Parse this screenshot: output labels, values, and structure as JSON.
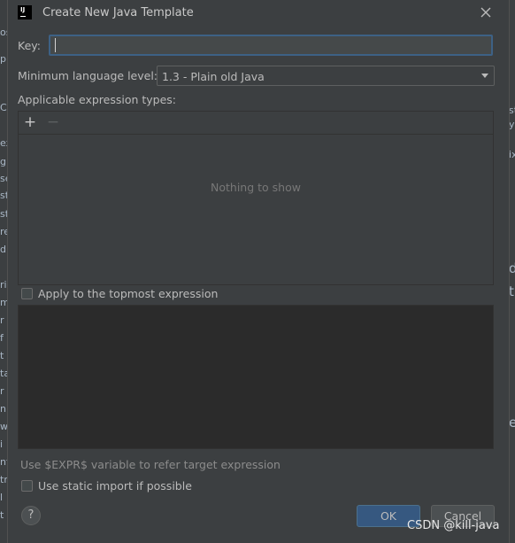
{
  "background_ide": {
    "left_fragments": [
      "os",
      "p",
      "Co",
      "ex",
      "g",
      "se",
      "st",
      "st",
      "re",
      "d",
      "ri",
      "m",
      "r",
      "f",
      "t",
      "ta",
      "r",
      "nl",
      "w",
      "i",
      "nt",
      "tr",
      "l",
      "t"
    ],
    "right_fragments": [
      "st",
      "y(",
      "ix",
      "d",
      "t",
      "e"
    ]
  },
  "dialog": {
    "title": "Create New Java Template",
    "app_icon_text": "IJ",
    "close_icon": "close-icon"
  },
  "form": {
    "key_label": "Key:",
    "key_value": "",
    "min_level_label": "Minimum language level:",
    "min_level_value": "1.3 - Plain old Java",
    "types_label": "Applicable expression types:",
    "add_symbol": "+",
    "remove_symbol": "−",
    "empty_text": "Nothing to show",
    "apply_topmost_label": "Apply to the topmost expression",
    "hint_text": "Use $EXPR$ variable to refer target expression",
    "static_import_label": "Use static import if possible"
  },
  "footer": {
    "help_symbol": "?",
    "ok_label": "OK",
    "cancel_label": "Cancel"
  },
  "watermark": "CSDN @kill-java",
  "colors": {
    "accent": "#365880",
    "focus_border": "#3d6185",
    "panel_bg": "#3c3f41",
    "editor_bg": "#2b2b2b"
  }
}
